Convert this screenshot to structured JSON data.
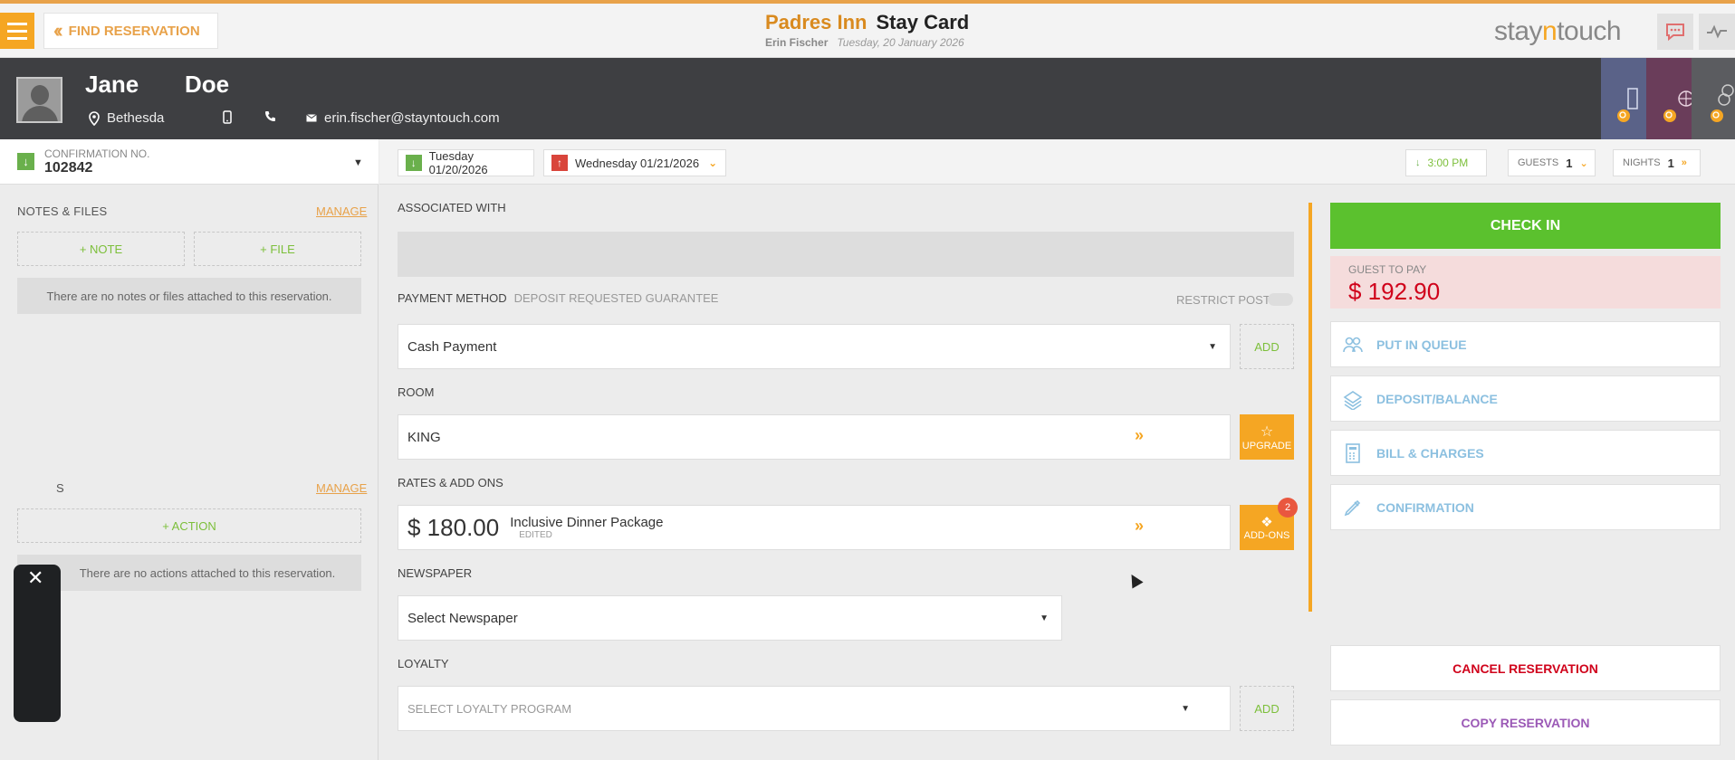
{
  "topbar": {
    "find_label": "FIND RESERVATION",
    "hotel_name": "Padres Inn",
    "card_title": "Stay Card",
    "user_name": "Erin Fischer",
    "business_date": "Tuesday, 20 January 2026",
    "brand_a": "stay",
    "brand_n": "n",
    "brand_b": "touch"
  },
  "guest": {
    "first_name": "Jane",
    "last_name": "Doe",
    "city": "Bethesda",
    "email": "erin.fischer@stayntouch.com"
  },
  "reservation": {
    "conf_label": "CONFIRMATION NO.",
    "conf_no": "102842"
  },
  "notes": {
    "title": "NOTES & FILES",
    "manage": "MANAGE",
    "add_note": "+ NOTE",
    "add_file": "+ FILE",
    "empty": "There are no notes or files attached to this reservation."
  },
  "actions": {
    "title": "S",
    "manage": "MANAGE",
    "add_action": "+ ACTION",
    "empty": "There are no actions attached to this reservation."
  },
  "dates": {
    "arrival": "Tuesday 01/20/2026",
    "departure": "Wednesday 01/21/2026",
    "time": "3:00 PM",
    "guests_label": "GUESTS",
    "guests_value": "1",
    "nights_label": "NIGHTS",
    "nights_value": "1"
  },
  "form": {
    "associated_label": "ASSOCIATED WITH",
    "payment_label": "PAYMENT METHOD",
    "payment_sub": "DEPOSIT REQUESTED GUARANTEE",
    "restrict_label": "RESTRICT POST",
    "payment_value": "Cash Payment",
    "add_label": "ADD",
    "room_label": "ROOM",
    "room_value": "KING",
    "upgrade_label": "UPGRADE",
    "rates_label": "RATES & ADD ONS",
    "rate_amount": "$ 180.00",
    "rate_name": "Inclusive Dinner Package",
    "rate_status": "EDITED",
    "addons_label": "ADD-ONS",
    "addons_count": "2",
    "newspaper_label": "NEWSPAPER",
    "newspaper_value": "Select Newspaper",
    "loyalty_label": "LOYALTY",
    "loyalty_value": "SELECT LOYALTY PROGRAM",
    "loyalty_add": "ADD"
  },
  "right": {
    "checkin": "CHECK IN",
    "pay_label": "GUEST TO PAY",
    "pay_amount": "$ 192.90",
    "queue": "PUT IN QUEUE",
    "deposit": "DEPOSIT/BALANCE",
    "bill": "BILL & CHARGES",
    "confirmation": "CONFIRMATION",
    "cancel": "CANCEL RESERVATION",
    "copy": "COPY RESERVATION"
  },
  "colors": {
    "accent": "#f5a623",
    "success": "#5bc12e",
    "danger": "#d0021b",
    "link": "#8cc0e0"
  }
}
